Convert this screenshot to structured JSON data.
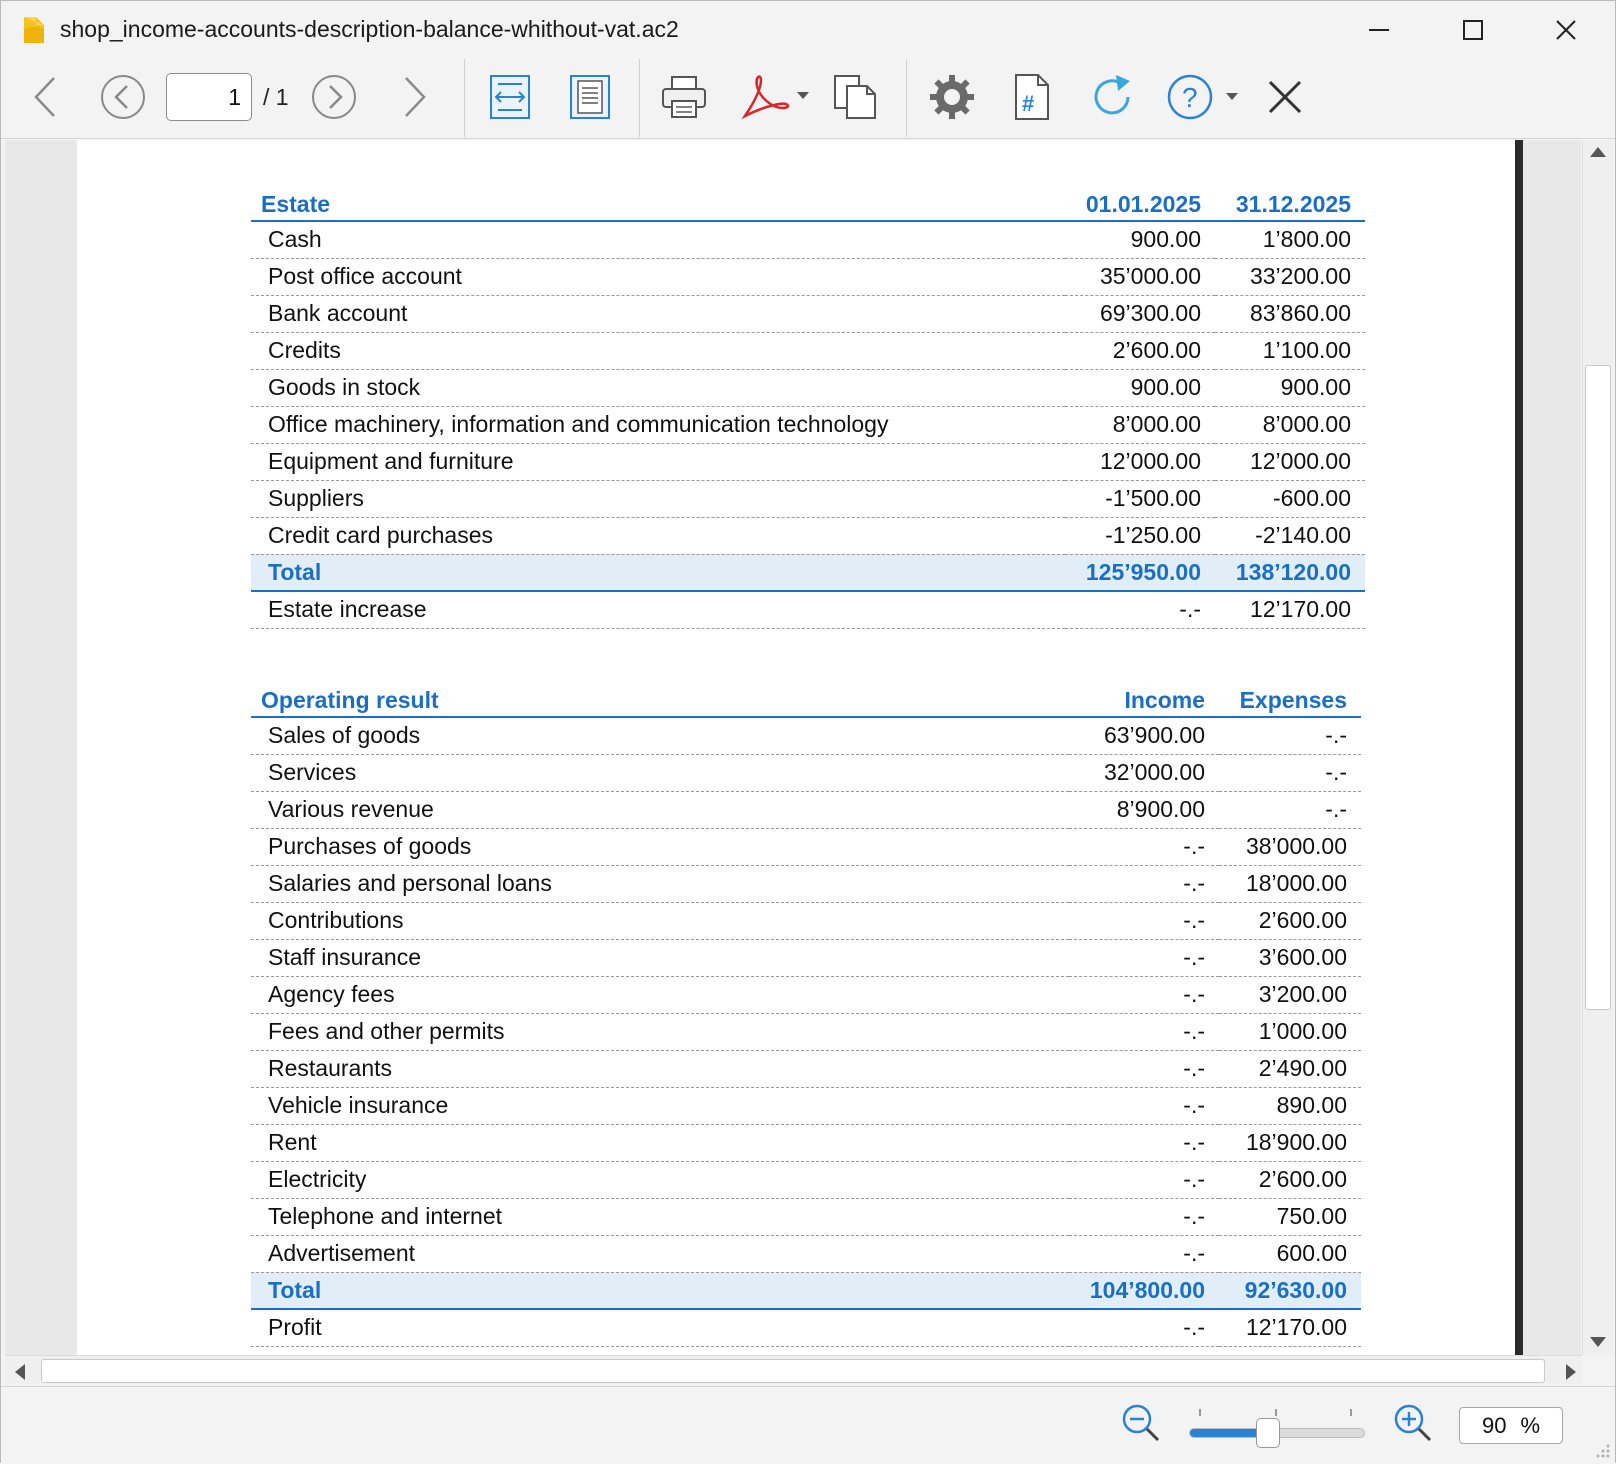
{
  "window": {
    "title": "shop_income-accounts-description-balance-whithout-vat.ac2"
  },
  "toolbar": {
    "page_current": "1",
    "page_total": "/ 1"
  },
  "estate": {
    "header": {
      "label": "Estate",
      "col1": "01.01.2025",
      "col2": "31.12.2025"
    },
    "rows": [
      {
        "label": "Cash",
        "v1": "900.00",
        "v2": "1’800.00"
      },
      {
        "label": "Post office account",
        "v1": "35’000.00",
        "v2": "33’200.00"
      },
      {
        "label": "Bank account",
        "v1": "69’300.00",
        "v2": "83’860.00"
      },
      {
        "label": "Credits",
        "v1": "2’600.00",
        "v2": "1’100.00"
      },
      {
        "label": "Goods in stock",
        "v1": "900.00",
        "v2": "900.00"
      },
      {
        "label": "Office machinery, information and communication technology",
        "v1": "8’000.00",
        "v2": "8’000.00"
      },
      {
        "label": "Equipment and furniture",
        "v1": "12’000.00",
        "v2": "12’000.00"
      },
      {
        "label": "Suppliers",
        "v1": "-1’500.00",
        "v2": "-600.00"
      },
      {
        "label": "Credit card purchases",
        "v1": "-1’250.00",
        "v2": "-2’140.00"
      }
    ],
    "total": {
      "label": "Total",
      "v1": "125’950.00",
      "v2": "138’120.00"
    },
    "after": {
      "label": "Estate increase",
      "v1": "-.-",
      "v2": "12’170.00"
    }
  },
  "operating": {
    "header": {
      "label": "Operating result",
      "col1": "Income",
      "col2": "Expenses"
    },
    "rows": [
      {
        "label": "Sales of goods",
        "v1": "63’900.00",
        "v2": "-.-"
      },
      {
        "label": "Services",
        "v1": "32’000.00",
        "v2": "-.-"
      },
      {
        "label": "Various revenue",
        "v1": "8’900.00",
        "v2": "-.-"
      },
      {
        "label": "Purchases of goods",
        "v1": "-.-",
        "v2": "38’000.00"
      },
      {
        "label": "Salaries and personal loans",
        "v1": "-.-",
        "v2": "18’000.00"
      },
      {
        "label": "Contributions",
        "v1": "-.-",
        "v2": "2’600.00"
      },
      {
        "label": "Staff insurance",
        "v1": "-.-",
        "v2": "3’600.00"
      },
      {
        "label": "Agency fees",
        "v1": "-.-",
        "v2": "3’200.00"
      },
      {
        "label": "Fees and other permits",
        "v1": "-.-",
        "v2": "1’000.00"
      },
      {
        "label": "Restaurants",
        "v1": "-.-",
        "v2": "2’490.00"
      },
      {
        "label": "Vehicle insurance",
        "v1": "-.-",
        "v2": "890.00"
      },
      {
        "label": "Rent",
        "v1": "-.-",
        "v2": "18’900.00"
      },
      {
        "label": "Electricity",
        "v1": "-.-",
        "v2": "2’600.00"
      },
      {
        "label": "Telephone and internet",
        "v1": "-.-",
        "v2": "750.00"
      },
      {
        "label": "Advertisement",
        "v1": "-.-",
        "v2": "600.00"
      }
    ],
    "total": {
      "label": "Total",
      "v1": "104’800.00",
      "v2": "92’630.00"
    },
    "after": {
      "label": "Profit",
      "v1": "-.-",
      "v2": "12’170.00"
    }
  },
  "statusbar": {
    "zoom_value": "90",
    "zoom_unit": "%",
    "zoom_slider_level": 0.45
  },
  "colors": {
    "accent": "#1a6fc4",
    "total_row_bg": "#e2eef7",
    "pdf_red": "#d9262b"
  }
}
